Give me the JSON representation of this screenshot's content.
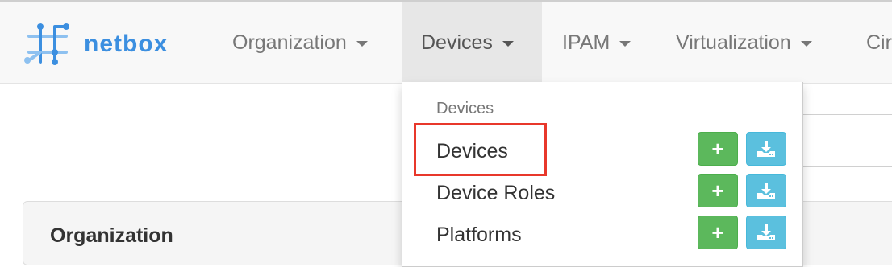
{
  "brand": {
    "name": "netbox",
    "logo_icon": "netbox-logo-icon",
    "color": "#3c8fe0"
  },
  "nav": [
    {
      "label": "Organization",
      "active": false
    },
    {
      "label": "Devices",
      "active": true
    },
    {
      "label": "IPAM",
      "active": false
    },
    {
      "label": "Virtualization",
      "active": false
    },
    {
      "label": "Cir",
      "active": false
    }
  ],
  "dropdown": {
    "header": "Devices",
    "items": [
      {
        "label": "Devices",
        "highlighted": true
      },
      {
        "label": "Device Roles"
      },
      {
        "label": "Platforms"
      }
    ],
    "add_glyph": "+",
    "add_icon": "plus-icon",
    "import_icon": "import-icon"
  },
  "panel": {
    "title": "Organization"
  },
  "colors": {
    "add_button": "#5cb85c",
    "import_button": "#5bc0de",
    "highlight": "#e8382b"
  }
}
